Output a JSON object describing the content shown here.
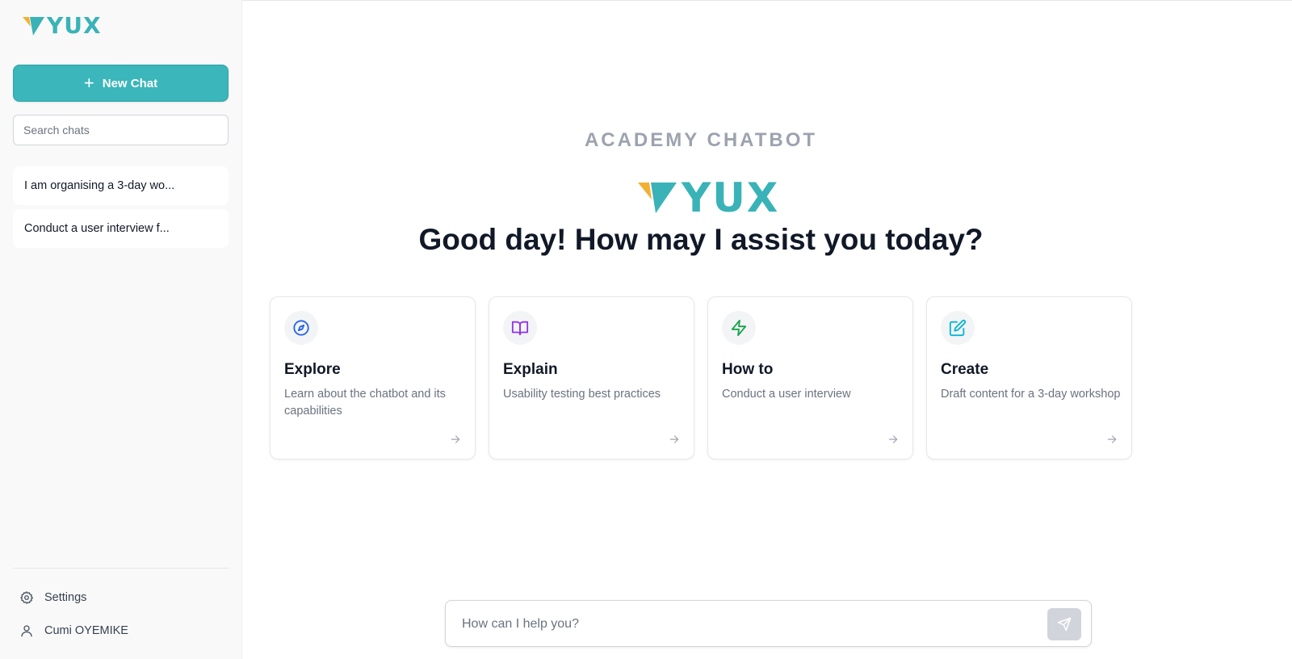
{
  "brand": {
    "name": "YUX",
    "primary_color": "#3bb6ba",
    "accent_color": "#f2b133"
  },
  "sidebar": {
    "new_chat_label": "New Chat",
    "search_placeholder": "Search chats",
    "chats": [
      {
        "title": "I am organising a 3-day wo..."
      },
      {
        "title": "Conduct a user interview f..."
      }
    ],
    "settings_label": "Settings",
    "user_name": "Cumi OYEMIKE"
  },
  "main": {
    "overline": "ACADEMY CHATBOT",
    "greeting": "Good day! How may I assist you today?",
    "cards": [
      {
        "icon": "compass-icon",
        "icon_color": "#2563eb",
        "title": "Explore",
        "description": "Learn about the chatbot and its capabilities"
      },
      {
        "icon": "book-open-icon",
        "icon_color": "#9333ea",
        "title": "Explain",
        "description": "Usability testing best practices"
      },
      {
        "icon": "lightning-icon",
        "icon_color": "#16a34a",
        "title": "How to",
        "description": "Conduct a user interview"
      },
      {
        "icon": "edit-icon",
        "icon_color": "#06b6d4",
        "title": "Create",
        "description": "Draft content for a 3-day workshop"
      }
    ],
    "composer": {
      "placeholder": "How can I help you?"
    }
  }
}
